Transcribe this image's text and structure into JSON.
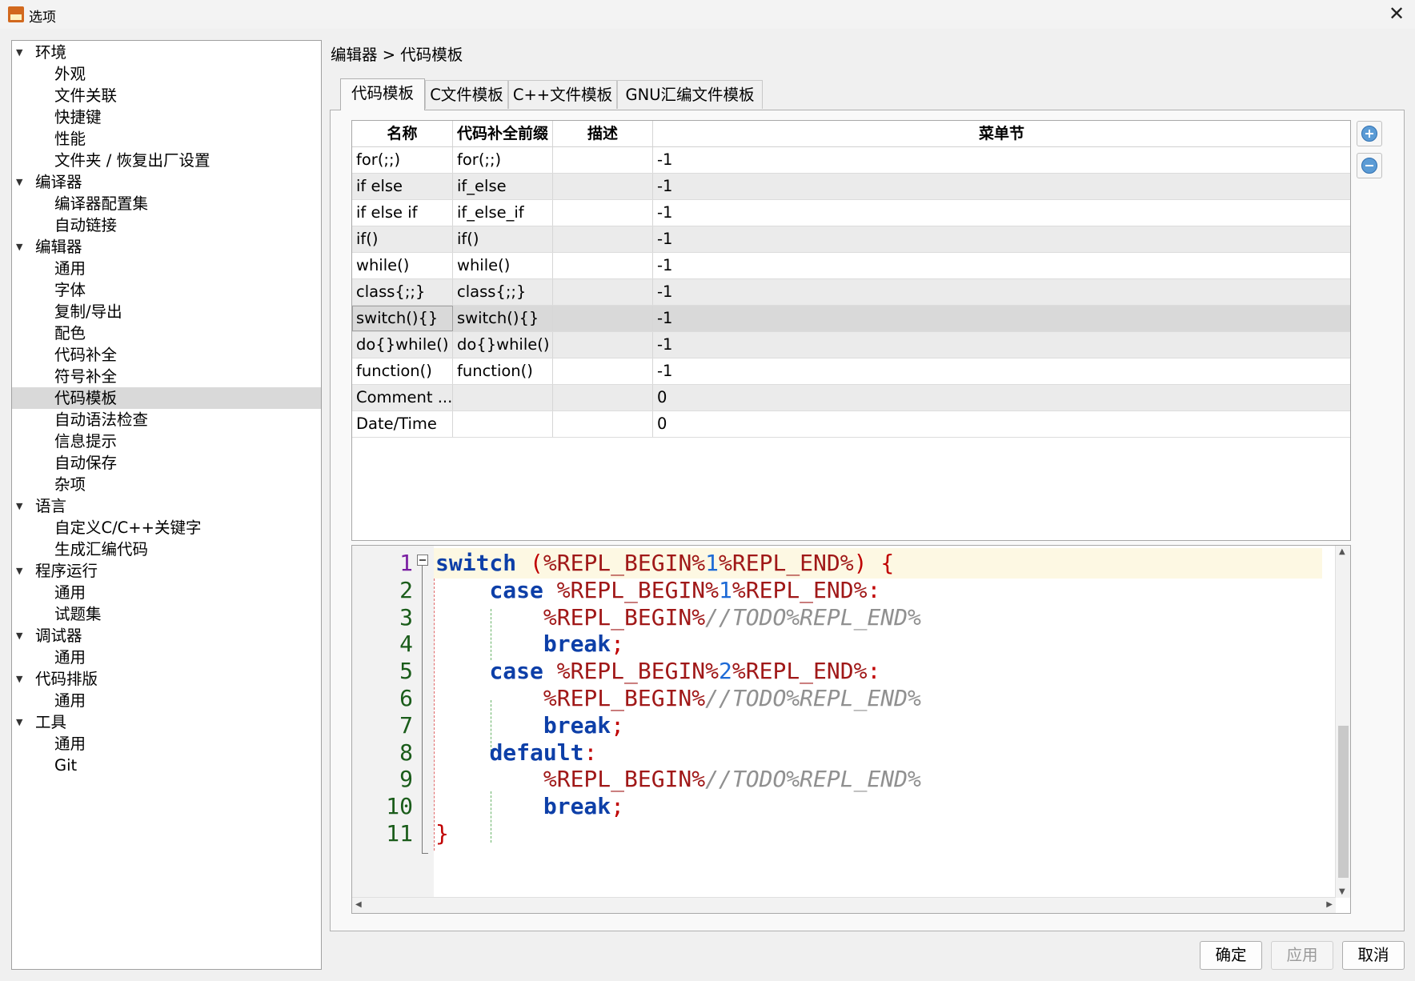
{
  "window": {
    "title": "选项",
    "close_glyph": "✕"
  },
  "tree": [
    {
      "label": "环境",
      "kind": "cat"
    },
    {
      "label": "外观",
      "kind": "child"
    },
    {
      "label": "文件关联",
      "kind": "child"
    },
    {
      "label": "快捷键",
      "kind": "child"
    },
    {
      "label": "性能",
      "kind": "child"
    },
    {
      "label": "文件夹 / 恢复出厂设置",
      "kind": "child"
    },
    {
      "label": "编译器",
      "kind": "cat"
    },
    {
      "label": "编译器配置集",
      "kind": "child"
    },
    {
      "label": "自动链接",
      "kind": "child"
    },
    {
      "label": "编辑器",
      "kind": "cat"
    },
    {
      "label": "通用",
      "kind": "child"
    },
    {
      "label": "字体",
      "kind": "child"
    },
    {
      "label": "复制/导出",
      "kind": "child"
    },
    {
      "label": "配色",
      "kind": "child"
    },
    {
      "label": "代码补全",
      "kind": "child"
    },
    {
      "label": "符号补全",
      "kind": "child"
    },
    {
      "label": "代码模板",
      "kind": "child",
      "selected": true
    },
    {
      "label": "自动语法检查",
      "kind": "child"
    },
    {
      "label": "信息提示",
      "kind": "child"
    },
    {
      "label": "自动保存",
      "kind": "child"
    },
    {
      "label": "杂项",
      "kind": "child"
    },
    {
      "label": "语言",
      "kind": "cat"
    },
    {
      "label": "自定义C/C++关键字",
      "kind": "child"
    },
    {
      "label": "生成汇编代码",
      "kind": "child"
    },
    {
      "label": "程序运行",
      "kind": "cat"
    },
    {
      "label": "通用",
      "kind": "child"
    },
    {
      "label": "试题集",
      "kind": "child"
    },
    {
      "label": "调试器",
      "kind": "cat"
    },
    {
      "label": "通用",
      "kind": "child"
    },
    {
      "label": "代码排版",
      "kind": "cat"
    },
    {
      "label": "通用",
      "kind": "child"
    },
    {
      "label": "工具",
      "kind": "cat"
    },
    {
      "label": "通用",
      "kind": "child"
    },
    {
      "label": "Git",
      "kind": "child"
    }
  ],
  "breadcrumb": "编辑器 > 代码模板",
  "tabs": [
    "代码模板",
    "C文件模板",
    "C++文件模板",
    "GNU汇编文件模板"
  ],
  "active_tab": 0,
  "table": {
    "headers": [
      "名称",
      "代码补全前缀",
      "描述",
      "菜单节"
    ],
    "rows": [
      [
        "for(;;)",
        "for(;;)",
        "",
        "-1"
      ],
      [
        "if else",
        "if_else",
        "",
        "-1"
      ],
      [
        "if else if",
        "if_else_if",
        "",
        "-1"
      ],
      [
        "if()",
        "if()",
        "",
        "-1"
      ],
      [
        "while()",
        "while()",
        "",
        "-1"
      ],
      [
        "class{;;}",
        "class{;;}",
        "",
        "-1"
      ],
      [
        "switch(){}",
        "switch(){}",
        "",
        "-1"
      ],
      [
        "do{}while()",
        "do{}while()",
        "",
        "-1"
      ],
      [
        "function()",
        "function()",
        "",
        "-1"
      ],
      [
        "Comment ...",
        "",
        "",
        "0"
      ],
      [
        "Date/Time",
        "",
        "",
        "0"
      ]
    ],
    "selected_row": 6
  },
  "side_buttons": {
    "add_icon": "plus-circle-icon",
    "remove_icon": "minus-circle-icon"
  },
  "editor": {
    "current_line": 1,
    "lines": [
      {
        "n": "1",
        "tokens": [
          [
            "kw",
            "switch"
          ],
          [
            "t",
            " "
          ],
          [
            "punc",
            "("
          ],
          [
            "repl",
            "%REPL_BEGIN%"
          ],
          [
            "num",
            "1"
          ],
          [
            "repl",
            "%REPL_END%"
          ],
          [
            "punc",
            ")"
          ],
          [
            "t",
            " "
          ],
          [
            "punc",
            "{"
          ]
        ]
      },
      {
        "n": "2",
        "tokens": [
          [
            "t",
            "    "
          ],
          [
            "kw",
            "case"
          ],
          [
            "t",
            " "
          ],
          [
            "repl",
            "%REPL_BEGIN%"
          ],
          [
            "num",
            "1"
          ],
          [
            "repl",
            "%REPL_END%"
          ],
          [
            "punc",
            ":"
          ]
        ]
      },
      {
        "n": "3",
        "tokens": [
          [
            "t",
            "        "
          ],
          [
            "repl",
            "%REPL_BEGIN%"
          ],
          [
            "cmt",
            "//TODO%REPL_END%"
          ]
        ]
      },
      {
        "n": "4",
        "tokens": [
          [
            "t",
            "        "
          ],
          [
            "kw",
            "break"
          ],
          [
            "punc",
            ";"
          ]
        ]
      },
      {
        "n": "5",
        "tokens": [
          [
            "t",
            "    "
          ],
          [
            "kw",
            "case"
          ],
          [
            "t",
            " "
          ],
          [
            "repl",
            "%REPL_BEGIN%"
          ],
          [
            "num",
            "2"
          ],
          [
            "repl",
            "%REPL_END%"
          ],
          [
            "punc",
            ":"
          ]
        ]
      },
      {
        "n": "6",
        "tokens": [
          [
            "t",
            "        "
          ],
          [
            "repl",
            "%REPL_BEGIN%"
          ],
          [
            "cmt",
            "//TODO%REPL_END%"
          ]
        ]
      },
      {
        "n": "7",
        "tokens": [
          [
            "t",
            "        "
          ],
          [
            "kw",
            "break"
          ],
          [
            "punc",
            ";"
          ]
        ]
      },
      {
        "n": "8",
        "tokens": [
          [
            "t",
            "    "
          ],
          [
            "kw",
            "default"
          ],
          [
            "punc",
            ":"
          ]
        ]
      },
      {
        "n": "9",
        "tokens": [
          [
            "t",
            "        "
          ],
          [
            "repl",
            "%REPL_BEGIN%"
          ],
          [
            "cmt",
            "//TODO%REPL_END%"
          ]
        ]
      },
      {
        "n": "10",
        "tokens": [
          [
            "t",
            "        "
          ],
          [
            "kw",
            "break"
          ],
          [
            "punc",
            ";"
          ]
        ]
      },
      {
        "n": "11",
        "tokens": [
          [
            "punc",
            "}"
          ]
        ]
      }
    ]
  },
  "buttons": {
    "ok": "确定",
    "apply": "应用",
    "cancel": "取消"
  }
}
